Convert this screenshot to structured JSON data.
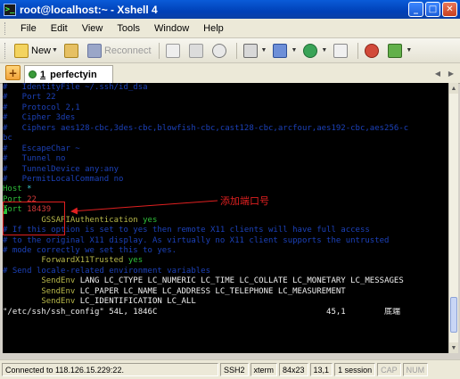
{
  "window": {
    "title": "root@localhost:~ - Xshell 4"
  },
  "menu": [
    "File",
    "Edit",
    "View",
    "Tools",
    "Window",
    "Help"
  ],
  "toolbar": {
    "new_label": "New",
    "reconnect_label": "Reconnect"
  },
  "tab": {
    "number": "1",
    "name": "perfectyin"
  },
  "terminal": {
    "lines": [
      {
        "segments": [
          {
            "t": "#   IdentityFile ~/.ssh/id_dsa",
            "c": "c-cm"
          }
        ]
      },
      {
        "segments": [
          {
            "t": "#   Port 22",
            "c": "c-cm"
          }
        ]
      },
      {
        "segments": [
          {
            "t": "#   Protocol 2,1",
            "c": "c-cm"
          }
        ]
      },
      {
        "segments": [
          {
            "t": "#   Cipher 3des",
            "c": "c-cm"
          }
        ]
      },
      {
        "segments": [
          {
            "t": "#   Ciphers aes128-cbc,3des-cbc,blowfish-cbc,cast128-cbc,arcfour,aes192-cbc,aes256-c",
            "c": "c-cm"
          }
        ]
      },
      {
        "segments": [
          {
            "t": "bc",
            "c": "c-cm"
          }
        ]
      },
      {
        "segments": [
          {
            "t": "#   EscapeChar ~",
            "c": "c-cm"
          }
        ]
      },
      {
        "segments": [
          {
            "t": "#   Tunnel no",
            "c": "c-cm"
          }
        ]
      },
      {
        "segments": [
          {
            "t": "#   TunnelDevice any:any",
            "c": "c-cm"
          }
        ]
      },
      {
        "segments": [
          {
            "t": "#   PermitLocalCommand no",
            "c": "c-cm"
          }
        ]
      },
      {
        "segments": [
          {
            "t": "Host",
            "c": "c-green"
          },
          {
            "t": " *",
            "c": "c-cyan"
          }
        ]
      },
      {
        "segments": [
          {
            "t": "Port",
            "c": "c-green"
          },
          {
            "t": " 22",
            "c": "c-red"
          }
        ]
      },
      {
        "segments": [
          {
            "t": "P",
            "c": "cursor"
          },
          {
            "t": "ort",
            "c": "c-green"
          },
          {
            "t": " 18439",
            "c": "c-red"
          }
        ]
      },
      {
        "segments": [
          {
            "t": "        GSSAPIAuthentication ",
            "c": "c-key"
          },
          {
            "t": "yes",
            "c": "c-green"
          }
        ]
      },
      {
        "segments": [
          {
            "t": "# If this option is set to yes then remote X11 clients will have full access",
            "c": "c-cm"
          }
        ]
      },
      {
        "segments": [
          {
            "t": "# to the original X11 display. As virtually no X11 client supports the untrusted",
            "c": "c-cm"
          }
        ]
      },
      {
        "segments": [
          {
            "t": "# mode correctly we set this to yes.",
            "c": "c-cm"
          }
        ]
      },
      {
        "segments": [
          {
            "t": "        ForwardX11Trusted ",
            "c": "c-key"
          },
          {
            "t": "yes",
            "c": "c-green"
          }
        ]
      },
      {
        "segments": [
          {
            "t": "# Send locale-related environment variables",
            "c": "c-cm"
          }
        ]
      },
      {
        "segments": [
          {
            "t": "        SendEnv ",
            "c": "c-key"
          },
          {
            "t": "LANG LC_CTYPE LC_NUMERIC LC_TIME LC_COLLATE LC_MONETARY LC_MESSAGES",
            "c": "c-white"
          }
        ]
      },
      {
        "segments": [
          {
            "t": "        SendEnv ",
            "c": "c-key"
          },
          {
            "t": "LC_PAPER LC_NAME LC_ADDRESS LC_TELEPHONE LC_MEASUREMENT",
            "c": "c-white"
          }
        ]
      },
      {
        "segments": [
          {
            "t": "        SendEnv ",
            "c": "c-key"
          },
          {
            "t": "LC_IDENTIFICATION LC_ALL",
            "c": "c-white"
          }
        ]
      },
      {
        "segments": [
          {
            "t": "\"/etc/ssh/ssh_config\" 54L, 1846C                                   45,1        底端",
            "c": "c-white"
          }
        ]
      }
    ]
  },
  "annotation": {
    "text": "添加端口号"
  },
  "status": {
    "connection": "Connected to 118.126.15.229:22.",
    "protocol": "SSH2",
    "term": "xterm",
    "size": "84x23",
    "cursor": "13,1",
    "sessions": "1 session",
    "cap": "CAP",
    "num": "NUM"
  }
}
